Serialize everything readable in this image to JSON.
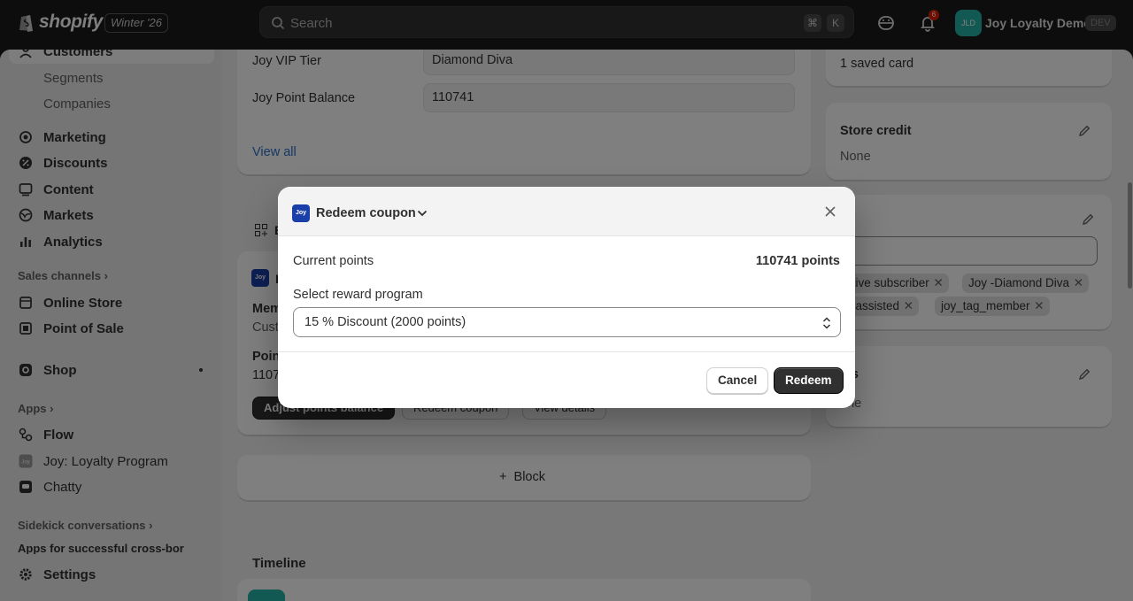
{
  "topbar": {
    "brand": "shopify",
    "edition": "Winter '26",
    "search_placeholder": "Search",
    "shortcut_cmd": "⌘",
    "shortcut_key": "K",
    "notification_count": "6",
    "avatar_initials": "JLD",
    "store_name": "Joy Loyalty Demo",
    "env_badge": "DEV"
  },
  "sidebar": {
    "customers": "Customers",
    "segments": "Segments",
    "companies": "Companies",
    "marketing": "Marketing",
    "discounts": "Discounts",
    "content": "Content",
    "markets": "Markets",
    "analytics": "Analytics",
    "sales_channels": "Sales channels",
    "online_store": "Online Store",
    "point_of_sale": "Point of Sale",
    "shop": "Shop",
    "apps": "Apps",
    "flow": "Flow",
    "joy_app": "Joy: Loyalty Program",
    "chatty": "Chatty",
    "sidekick": "Sidekick conversations",
    "sidekick_item": "Apps for successful cross-bor",
    "settings": "Settings"
  },
  "metafields": {
    "vip_label": "Joy VIP Tier",
    "vip_value": "Diamond Diva",
    "points_label": "Joy Point Balance",
    "points_value": "110741",
    "view_all": "View all"
  },
  "loyalty_block": {
    "header_partial": "B",
    "app_partial": "L",
    "member_partial": "Mem",
    "customer_partial": "Cust",
    "points_partial": "Poin",
    "points_value_partial": "1107",
    "adjust_button": "Adjust points balance",
    "redeem_button": "Redeem coupon",
    "details_button": "View details"
  },
  "add_block": "Block",
  "timeline_title": "Timeline",
  "right_panel": {
    "saved_card": "1 saved card",
    "store_credit_title": "Store credit",
    "store_credit_value": "None",
    "tags_title_partial": "gs",
    "tags": [
      "ctive subscriber",
      "Joy -Diamond Diva",
      "y assisted",
      "joy_tag_member"
    ],
    "notes_title_partial": "tes",
    "notes_value_partial": "one"
  },
  "modal": {
    "app_logo_text": "Joy",
    "title": "Redeem coupon",
    "current_points_label": "Current points",
    "current_points_value": "110741 points",
    "select_label": "Select reward program",
    "selected_program": "15 % Discount (2000 points)",
    "cancel_label": "Cancel",
    "redeem_label": "Redeem"
  }
}
